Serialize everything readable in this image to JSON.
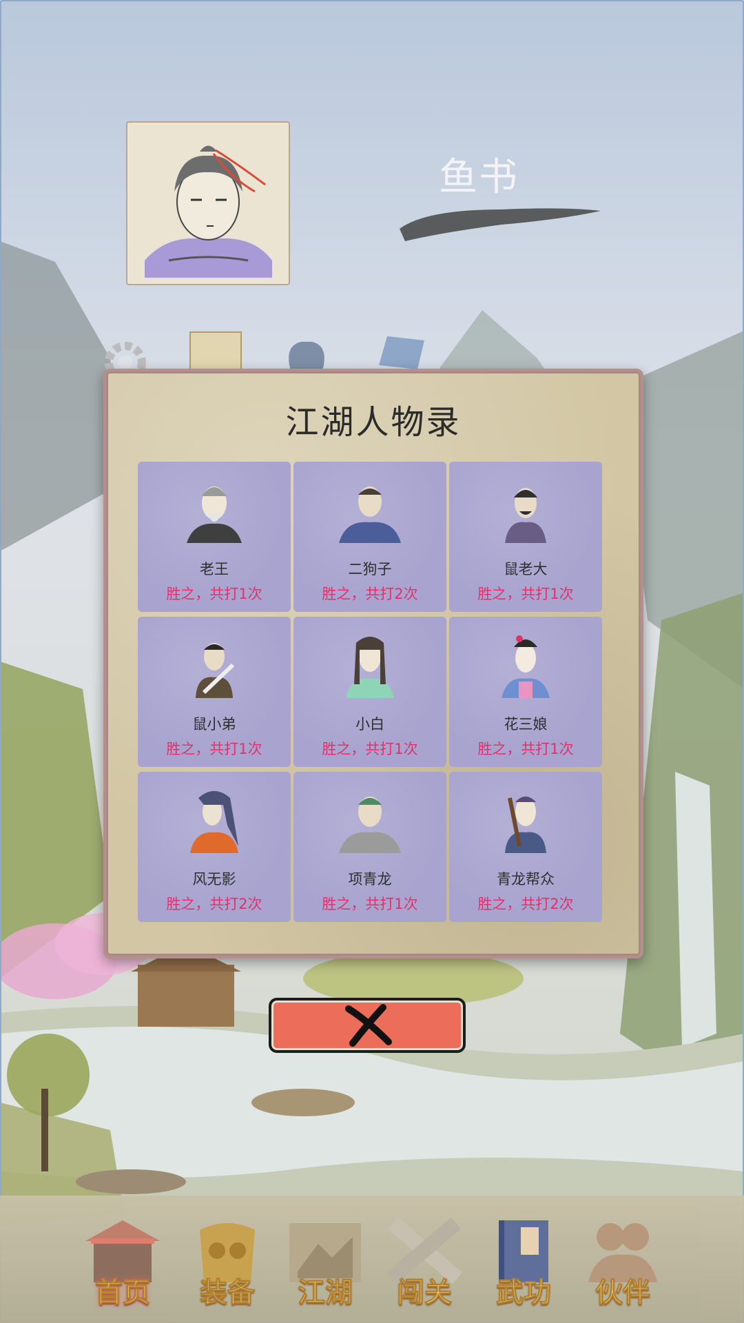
{
  "header": {
    "player_name": "鱼书"
  },
  "modal": {
    "title": "江湖人物录",
    "characters": [
      {
        "name": "老王",
        "record": "胜之，共打1次"
      },
      {
        "name": "二狗子",
        "record": "胜之，共打2次"
      },
      {
        "name": "鼠老大",
        "record": "胜之，共打1次"
      },
      {
        "name": "鼠小弟",
        "record": "胜之，共打1次"
      },
      {
        "name": "小白",
        "record": "胜之，共打1次"
      },
      {
        "name": "花三娘",
        "record": "胜之，共打1次"
      },
      {
        "name": "风无影",
        "record": "胜之，共打2次"
      },
      {
        "name": "项青龙",
        "record": "胜之，共打1次"
      },
      {
        "name": "青龙帮众",
        "record": "胜之，共打2次"
      }
    ]
  },
  "close_button": {
    "icon": "close-icon"
  },
  "nav": {
    "items": [
      {
        "label": "首页",
        "icon": "temple-icon",
        "active": true
      },
      {
        "label": "装备",
        "icon": "armor-icon",
        "active": false
      },
      {
        "label": "江湖",
        "icon": "scroll-map-icon",
        "active": false
      },
      {
        "label": "闯关",
        "icon": "crossed-swords-icon",
        "active": false
      },
      {
        "label": "武功",
        "icon": "book-icon",
        "active": false
      },
      {
        "label": "伙伴",
        "icon": "partners-icon",
        "active": false
      }
    ]
  },
  "colors": {
    "record_text": "#e0316a",
    "card_bg": "#a9a4cf",
    "close_button": "#eb6d5a",
    "nav_label": "#f0d37a"
  }
}
